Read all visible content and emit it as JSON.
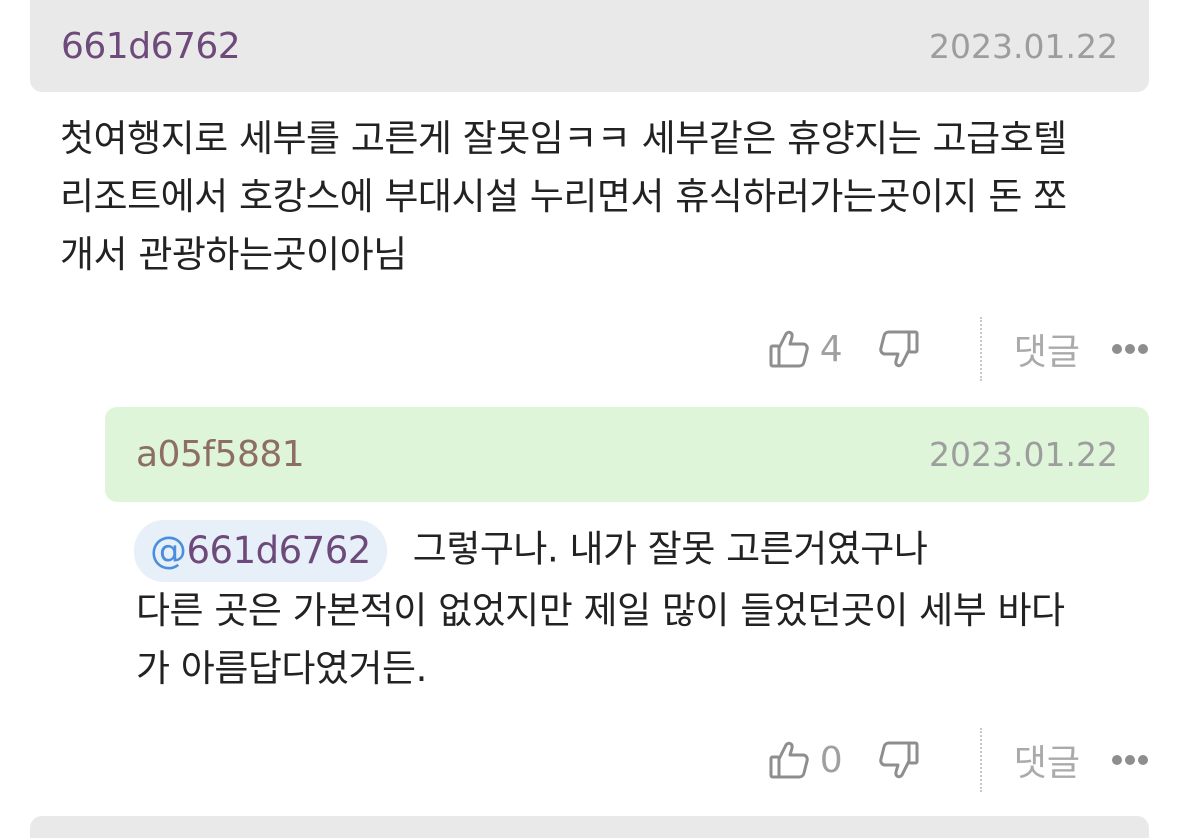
{
  "comments": [
    {
      "username": "661d6762",
      "date": "2023.01.22",
      "lines": [
        "첫여행지로 세부를 고른게 잘못임ㅋㅋ 세부같은 휴양지는 고급호텔",
        "리조트에서 호캉스에 부대시설 누리면서 휴식하러가는곳이지 돈 쪼",
        "개서 관광하는곳이아님"
      ],
      "likes": "4",
      "reply_label": "댓글"
    }
  ],
  "reply": {
    "username": "a05f5881",
    "date": "2023.01.22",
    "mention_at": "@",
    "mention_handle": "661d6762",
    "first_line": "그렇구나. 내가 잘못 고른거였구나",
    "lines": [
      "다른 곳은 가본적이 없었지만 제일 많이 들었던곳이 세부 바다",
      "가 아름답다였거든."
    ],
    "likes": "0",
    "reply_label": "댓글"
  },
  "icons": {
    "like": "thumbs-up-icon",
    "dislike": "thumbs-down-icon",
    "more": "more-dots-icon"
  },
  "colors": {
    "header_gray": "#e9e9e9",
    "header_green": "#dff5d9",
    "username_purple": "#6d4a7a",
    "username_brown": "#8c6e62",
    "mention_blue": "#4b8edc"
  }
}
